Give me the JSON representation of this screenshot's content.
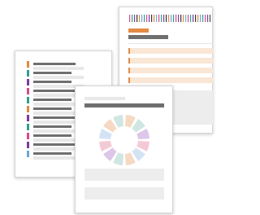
{
  "illustration": {
    "back_document": {
      "barcode_colors": [
        "#d64b8e",
        "#2f9e8f",
        "#7b3aa3",
        "#333333",
        "#e08a3c",
        "#6aa7d8",
        "#2f9e8f",
        "#d64b8e",
        "#7b3aa3",
        "#333333",
        "#e08a3c",
        "#6aa7d8"
      ],
      "accent_color": "#e38a46",
      "row_fill_color": "#fae6d5",
      "row_count": 4
    },
    "left_document": {
      "tag_colors": [
        "#e08a3c",
        "#2f9e8f",
        "#7b3aa3",
        "#d64b8e",
        "#2f9e8f",
        "#e08a3c",
        "#7b3aa3",
        "#2f9e8f",
        "#d64b8e",
        "#7b3aa3",
        "#6aa7d8"
      ],
      "line_color": "#6f6f6f"
    },
    "front_document": {
      "ring_colors": [
        "#f6d9c2",
        "#cfe6e2",
        "#dcc7e8",
        "#f4c9d6",
        "#d4e3f4",
        "#f6d9c2",
        "#cfe6e2",
        "#dcc7e8",
        "#f4c9d6",
        "#d4e3f4",
        "#f6d9c2",
        "#cfe6e2"
      ],
      "header_color": "#6f6f6f"
    }
  }
}
